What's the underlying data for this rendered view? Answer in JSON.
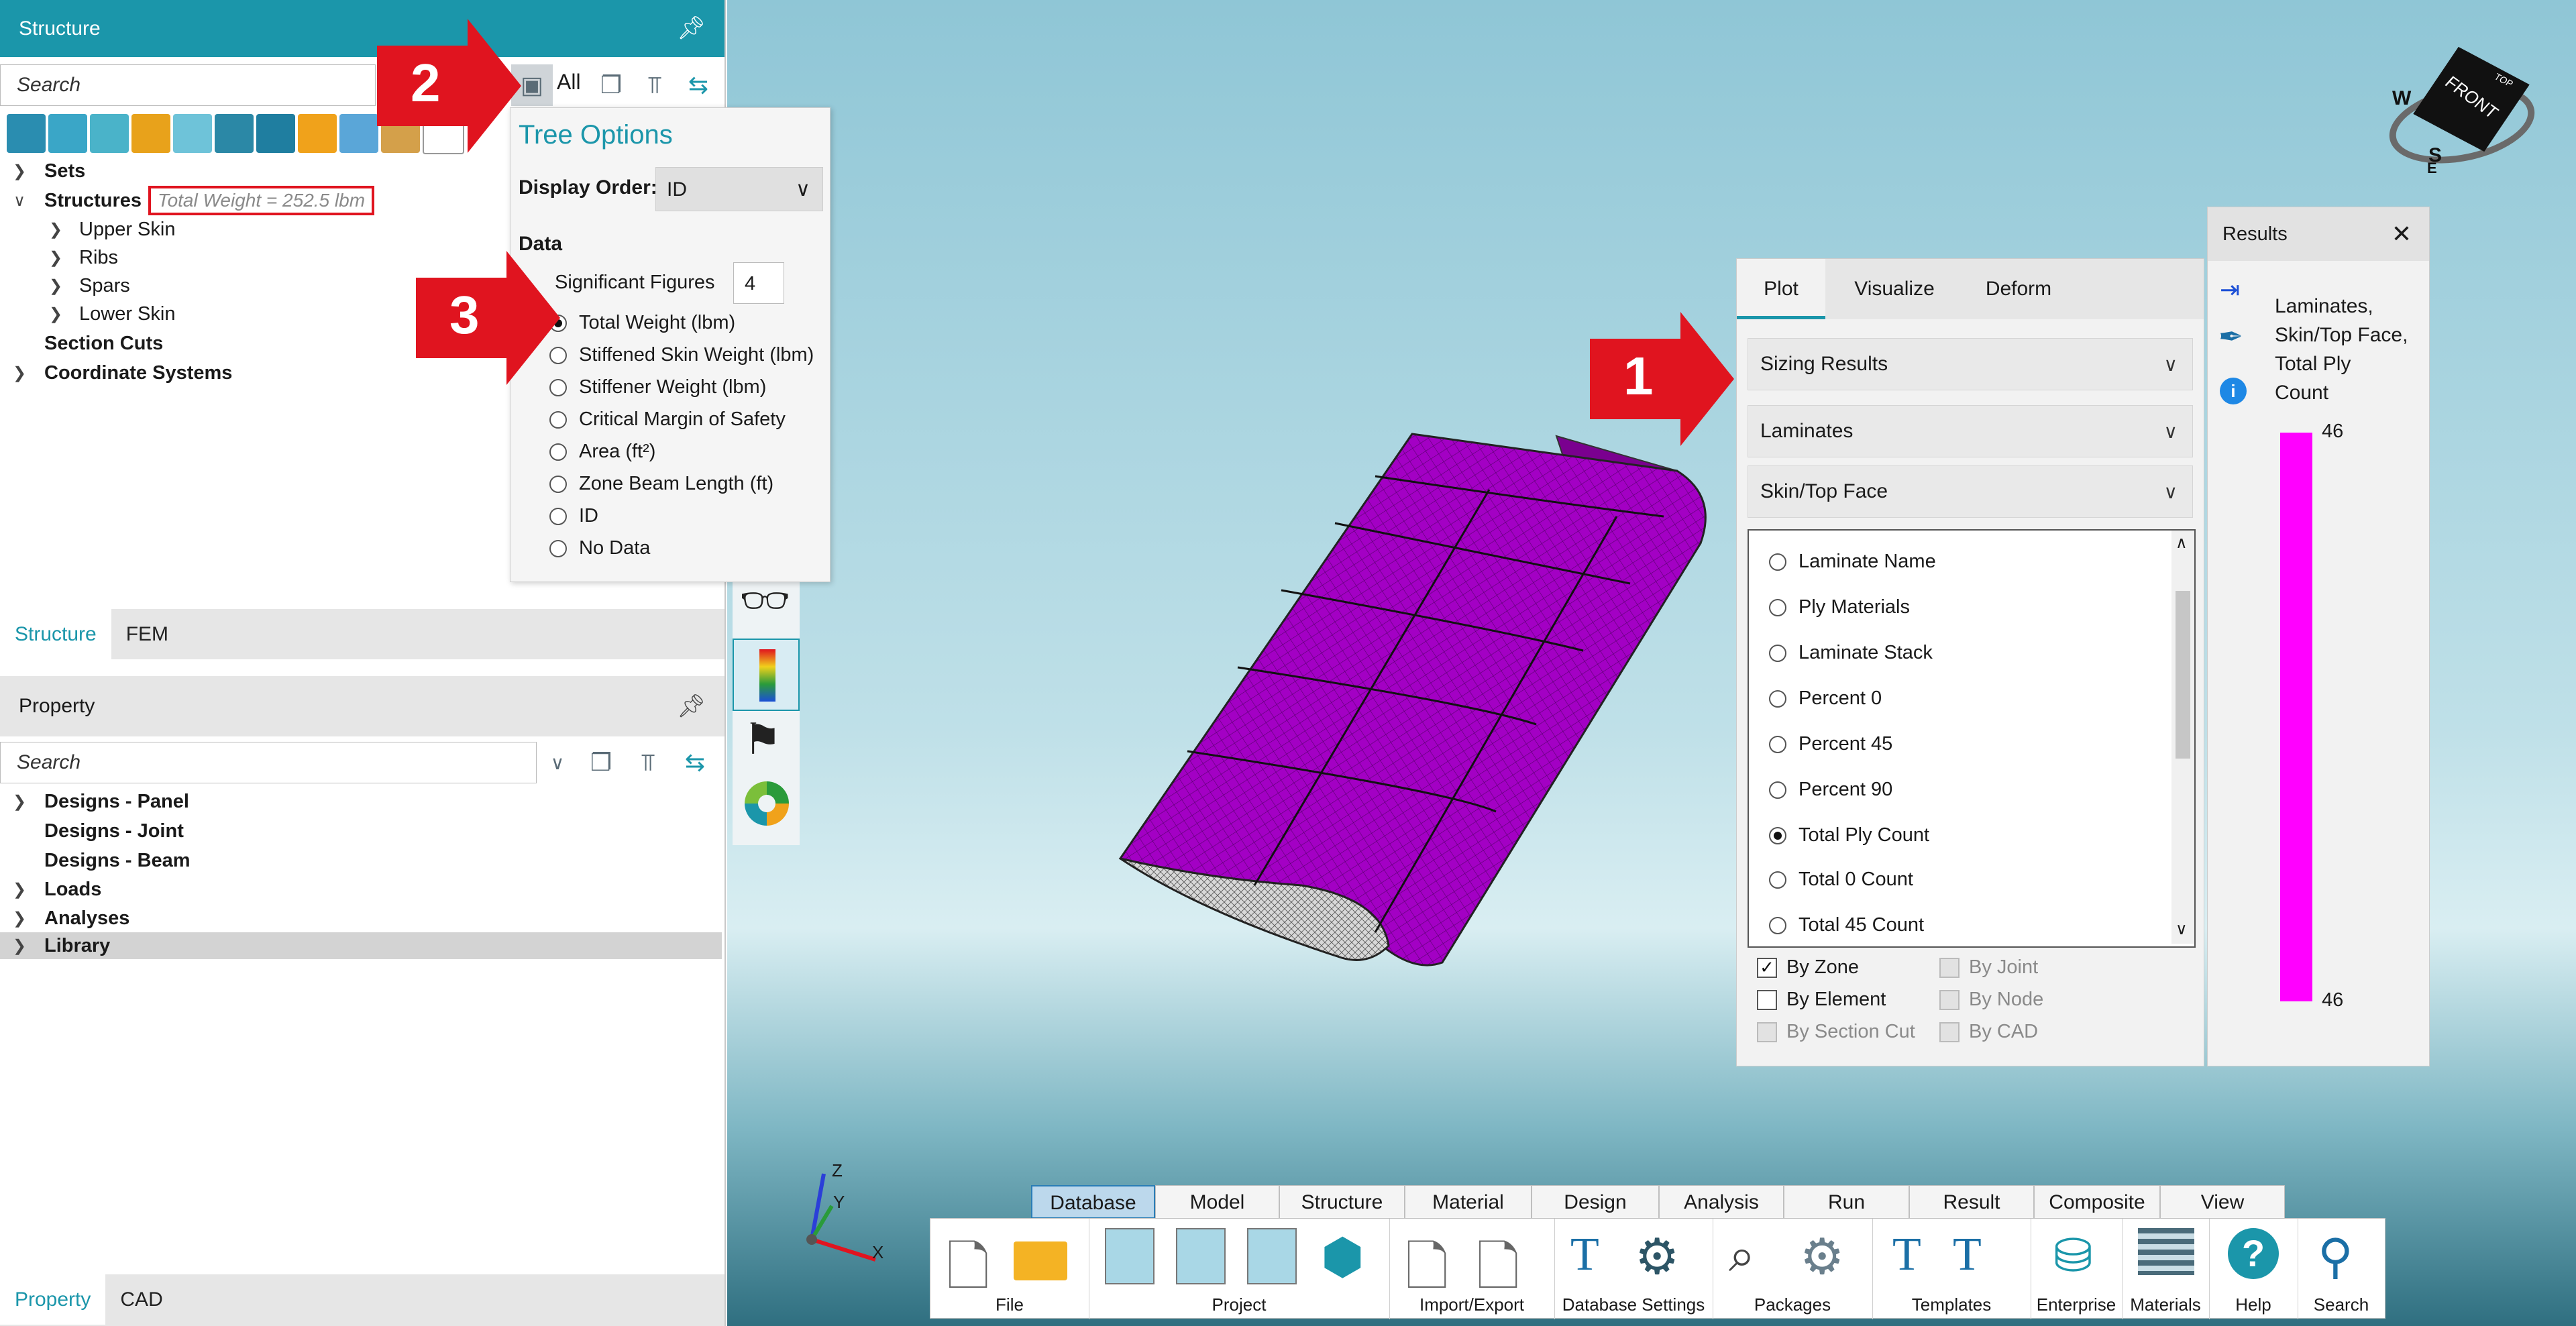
{
  "structure_panel": {
    "title": "Structure",
    "search_placeholder": "Search",
    "all_label": "All",
    "tree": {
      "sets": "Sets",
      "structures": "Structures",
      "total_weight": "Total Weight = 252.5 lbm",
      "upper_skin": "Upper Skin",
      "ribs": "Ribs",
      "spars": "Spars",
      "lower_skin": "Lower Skin",
      "section_cuts": "Section Cuts",
      "coordinate_systems": "Coordinate Systems"
    },
    "tabs": [
      "Structure",
      "FEM"
    ]
  },
  "property_panel": {
    "title": "Property",
    "search_placeholder": "Search",
    "tree": [
      "Designs - Panel",
      "Designs - Joint",
      "Designs - Beam",
      "Loads",
      "Analyses",
      "Library"
    ],
    "tabs": [
      "Property",
      "CAD"
    ]
  },
  "tree_options": {
    "title": "Tree Options",
    "display_order_label": "Display Order:",
    "display_order_value": "ID",
    "data_label": "Data",
    "sig_figs_label": "Significant Figures",
    "sig_figs_value": "4",
    "options": [
      "Total Weight (lbm)",
      "Stiffened Skin Weight (lbm)",
      "Stiffener Weight (lbm)",
      "Critical Margin of Safety",
      "Area (ft²)",
      "Zone Beam Length (ft)",
      "ID",
      "No Data"
    ],
    "selected_index": 0
  },
  "plot_panel": {
    "tabs": [
      "Plot",
      "Visualize",
      "Deform"
    ],
    "active_tab": "Plot",
    "dropdowns": [
      "Sizing Results",
      "Laminates",
      "Skin/Top Face"
    ],
    "list": [
      "Laminate Name",
      "Ply Materials",
      "Laminate Stack",
      "Percent 0",
      "Percent 45",
      "Percent 90",
      "Total Ply Count",
      "Total 0 Count",
      "Total 45 Count"
    ],
    "list_selected_index": 6,
    "checks": {
      "by_zone": "By Zone",
      "by_element": "By Element",
      "by_section_cut": "By Section Cut",
      "by_joint": "By Joint",
      "by_node": "By Node",
      "by_cad": "By CAD"
    }
  },
  "results_panel": {
    "title": "Results",
    "description": "Laminates, Skin/Top Face, Total Ply Count",
    "legend_max": "46",
    "legend_min": "46",
    "legend_color": "#ff00ff"
  },
  "callouts": [
    "1",
    "2",
    "3"
  ],
  "view_cube": {
    "face": "FRONT",
    "top": "TOP",
    "compass": [
      "W",
      "S",
      "E"
    ]
  },
  "axes": {
    "z": "Z",
    "y": "Y",
    "x": "X"
  },
  "ribbon": {
    "tabs": [
      "Database",
      "Model",
      "Structure",
      "Material",
      "Design",
      "Analysis",
      "Run",
      "Result",
      "Composite",
      "View"
    ],
    "active_tab": "Database",
    "groups": [
      "File",
      "Project",
      "Import/Export",
      "Database Settings",
      "Packages",
      "Templates",
      "Enterprise",
      "Materials",
      "Help",
      "Search"
    ]
  },
  "colors": {
    "accent": "#1b96aa",
    "callout_red": "#e0141f",
    "wing": "#a300c4"
  }
}
